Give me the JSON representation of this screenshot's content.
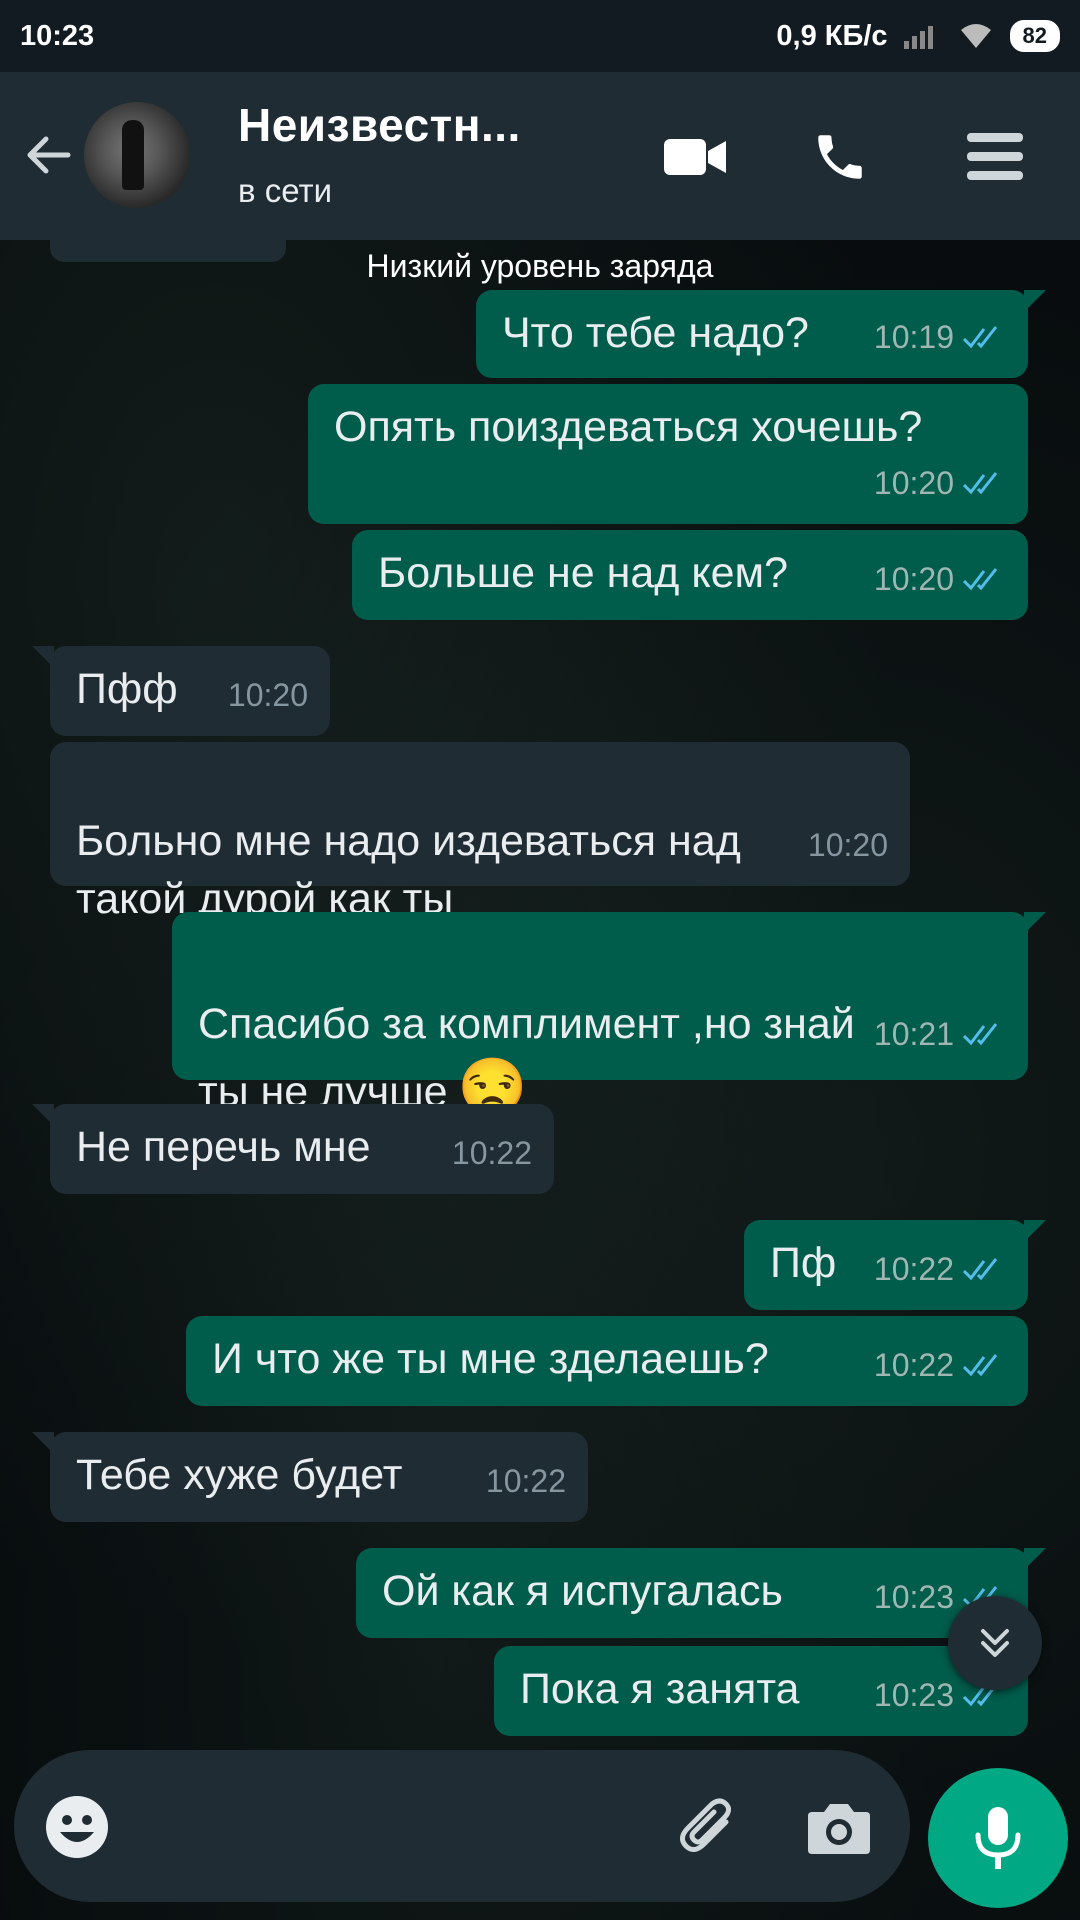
{
  "status_bar": {
    "time": "10:23",
    "speed": "0,9 КБ/с",
    "battery": "82"
  },
  "header": {
    "contact_name": "Неизвестн...",
    "contact_status": "в сети"
  },
  "system_note": "Низкий уровень заряда",
  "messages": [
    {
      "text": "Что тебе надо?",
      "time": "10:19"
    },
    {
      "text": "Опять поиздеваться хочешь?",
      "time": "10:20"
    },
    {
      "text": "Больше не над кем?",
      "time": "10:20"
    },
    {
      "text": "Пфф",
      "time": "10:20"
    },
    {
      "text": "Больно мне надо издеваться над\nтакой дурой как ты",
      "time": "10:20"
    },
    {
      "text": "Спасибо за комплимент ,но знай\nты не лучше",
      "emoji": "😒",
      "time": "10:21"
    },
    {
      "text": "Не перечь мне",
      "time": "10:22"
    },
    {
      "text": "Пф",
      "time": "10:22"
    },
    {
      "text": "И что же ты мне зделаешь?",
      "time": "10:22"
    },
    {
      "text": "Тебе хуже будет",
      "time": "10:22"
    },
    {
      "text": "Ой как я испугалась",
      "time": "10:23"
    },
    {
      "text": "Пока я занята",
      "time": "10:23"
    }
  ],
  "colors": {
    "outgoing": "#005c4b",
    "incoming": "#202c33",
    "accent": "#00a884",
    "read_ticks": "#53bdeb"
  },
  "icons": [
    "back-arrow-icon",
    "video-call-icon",
    "phone-icon",
    "menu-icon",
    "double-check-icon",
    "chevron-double-down-icon",
    "emoji-icon",
    "attach-icon",
    "camera-icon",
    "mic-icon"
  ]
}
